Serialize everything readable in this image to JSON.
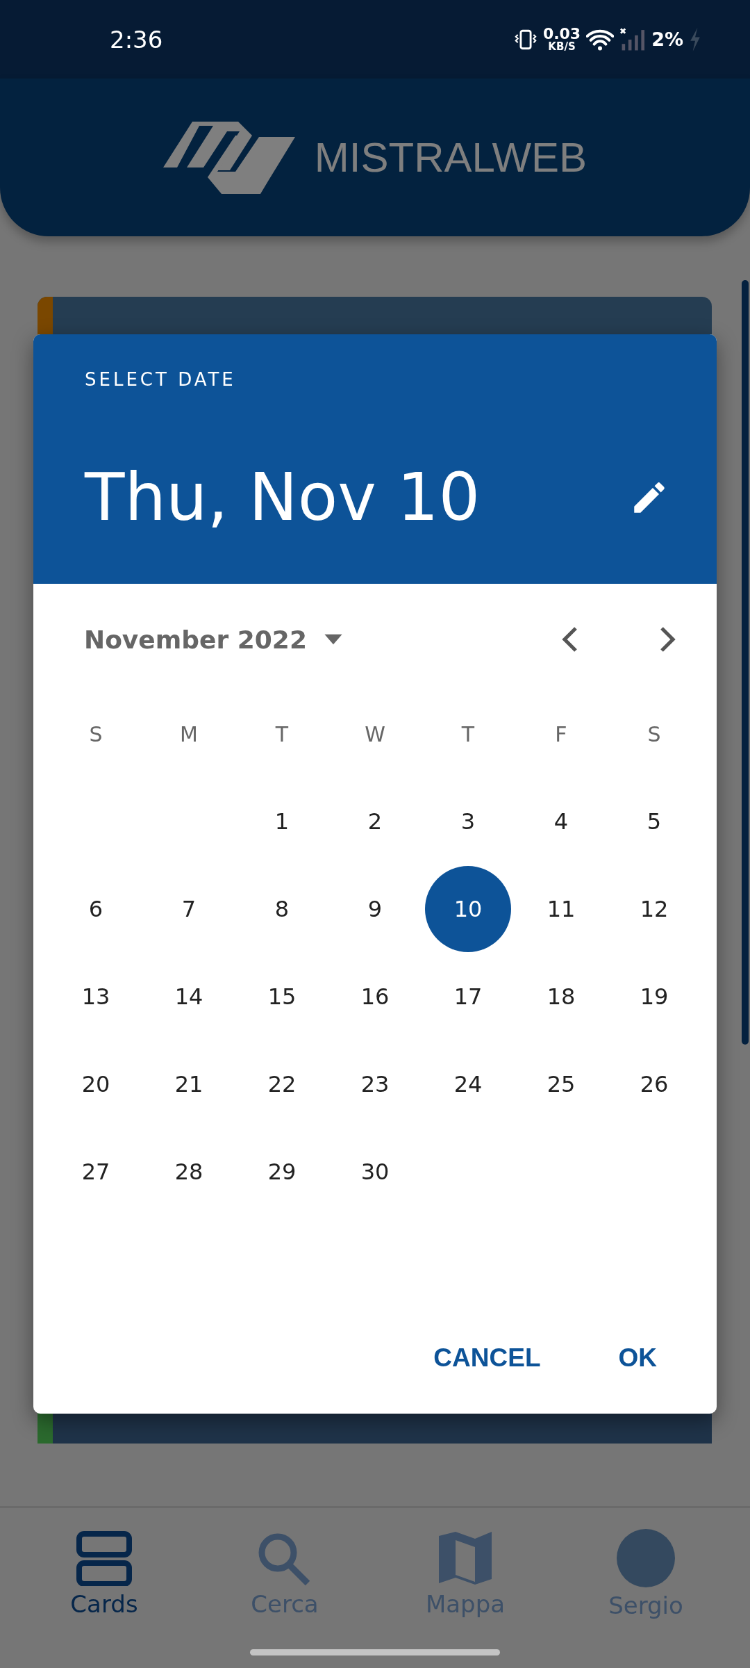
{
  "status_bar": {
    "time": "2:36",
    "net_speed": "0.03",
    "net_unit": "KB/S",
    "battery": "2%"
  },
  "app_header": {
    "logo_text": "MISTRALWEB"
  },
  "background_cards": [
    {
      "color": "#7a4700"
    },
    {
      "color": "#2b6a2e"
    }
  ],
  "date_picker": {
    "title": "SELECT DATE",
    "selected_date": "Thu, Nov 10",
    "month_label": "November 2022",
    "weekdays": [
      "S",
      "M",
      "T",
      "W",
      "T",
      "F",
      "S"
    ],
    "weeks": [
      [
        {
          "kind": "blank"
        },
        {
          "kind": "blank"
        },
        {
          "kind": "day",
          "label": "1",
          "selected": false
        },
        {
          "kind": "day",
          "label": "2",
          "selected": false
        },
        {
          "kind": "day",
          "label": "3",
          "selected": false
        },
        {
          "kind": "day",
          "label": "4",
          "selected": false
        },
        {
          "kind": "day",
          "label": "5",
          "selected": false
        }
      ],
      [
        {
          "kind": "day",
          "label": "6",
          "selected": false
        },
        {
          "kind": "day",
          "label": "7",
          "selected": false
        },
        {
          "kind": "day",
          "label": "8",
          "selected": false
        },
        {
          "kind": "day",
          "label": "9",
          "selected": false
        },
        {
          "kind": "day",
          "label": "10",
          "selected": true
        },
        {
          "kind": "day",
          "label": "11",
          "selected": false
        },
        {
          "kind": "day",
          "label": "12",
          "selected": false
        }
      ],
      [
        {
          "kind": "day",
          "label": "13",
          "selected": false
        },
        {
          "kind": "day",
          "label": "14",
          "selected": false
        },
        {
          "kind": "day",
          "label": "15",
          "selected": false
        },
        {
          "kind": "day",
          "label": "16",
          "selected": false
        },
        {
          "kind": "day",
          "label": "17",
          "selected": false
        },
        {
          "kind": "day",
          "label": "18",
          "selected": false
        },
        {
          "kind": "day",
          "label": "19",
          "selected": false
        }
      ],
      [
        {
          "kind": "day",
          "label": "20",
          "selected": false
        },
        {
          "kind": "day",
          "label": "21",
          "selected": false
        },
        {
          "kind": "day",
          "label": "22",
          "selected": false
        },
        {
          "kind": "day",
          "label": "23",
          "selected": false
        },
        {
          "kind": "day",
          "label": "24",
          "selected": false
        },
        {
          "kind": "day",
          "label": "25",
          "selected": false
        },
        {
          "kind": "day",
          "label": "26",
          "selected": false
        }
      ],
      [
        {
          "kind": "day",
          "label": "27",
          "selected": false
        },
        {
          "kind": "day",
          "label": "28",
          "selected": false
        },
        {
          "kind": "day",
          "label": "29",
          "selected": false
        },
        {
          "kind": "day",
          "label": "30",
          "selected": false
        }
      ]
    ],
    "buttons": [
      {
        "label": "CANCEL"
      },
      {
        "label": "OK"
      }
    ]
  },
  "bottom_nav": [
    {
      "label": "Cards",
      "kind": "cards",
      "selected": true
    },
    {
      "label": "Cerca",
      "kind": "search",
      "selected": false
    },
    {
      "label": "Mappa",
      "kind": "map",
      "selected": false
    },
    {
      "label": "Sergio",
      "kind": "avatar",
      "selected": false
    }
  ]
}
